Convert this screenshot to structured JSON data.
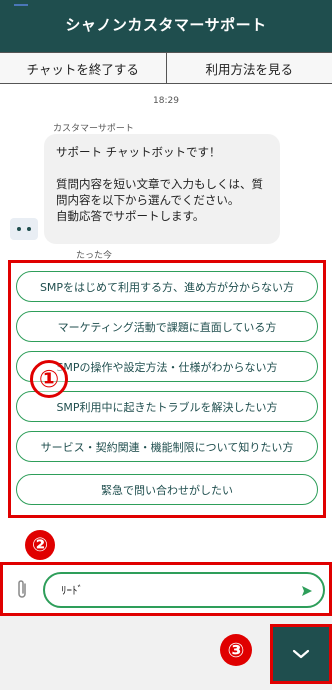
{
  "header": {
    "title": "シャノンカスタマーサポート"
  },
  "tabs": {
    "end_chat": "チャットを終了する",
    "how_to_use": "利用方法を見る"
  },
  "chat": {
    "timestamp": "18:29",
    "sender": "カスタマーサポート",
    "message": "サポート チャットボットです！\n\n質問内容を短い文章で入力もしくは、質問内容を以下から選んでください。\n自動応答でサポートします。",
    "time_ago": "たった今"
  },
  "options": [
    "SMPをはじめて利用する方、進め方が分からない方",
    "マーケティング活動で課題に直面している方",
    "SMPの操作や設定方法・仕様がわからない方",
    "SMP利用中に起きたトラブルを解決したい方",
    "サービス・契約関連・機能制限について知りたい方",
    "緊急で問い合わせがしたい"
  ],
  "annotations": {
    "one": "①",
    "two": "②",
    "three": "③"
  },
  "input": {
    "value": "ﾘｰﾄﾞ"
  },
  "colors": {
    "header": "#1f4e4e",
    "accent": "#2e9e5a",
    "annotation": "#e00000"
  },
  "icons": {
    "attach": "paperclip-icon",
    "send": "send-icon",
    "toggle": "chevron-down-icon"
  }
}
